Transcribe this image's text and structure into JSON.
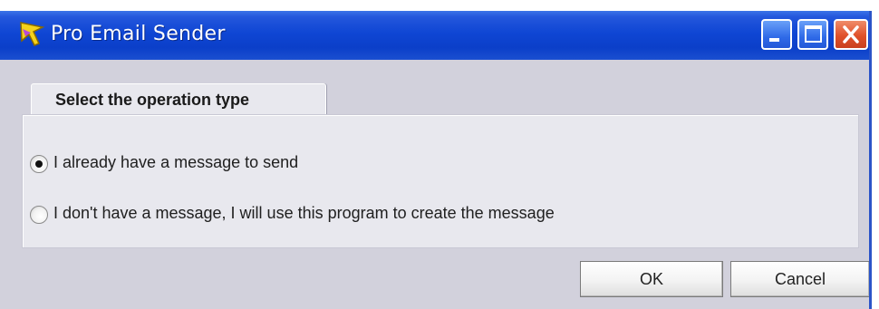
{
  "window": {
    "title": "Pro Email Sender",
    "icon": "yellow-arrow-icon",
    "controls": {
      "minimize": "minimize-icon",
      "maximize": "maximize-icon",
      "close": "close-icon"
    }
  },
  "tab": {
    "label": "Select the operation type"
  },
  "options": [
    {
      "label": "I already have a message to send",
      "selected": true
    },
    {
      "label": "I don't have a message, I will use this program to create the message",
      "selected": false
    }
  ],
  "buttons": {
    "ok_label": "OK",
    "cancel_label": "Cancel"
  },
  "colors": {
    "titlebar": "#0b3fc9",
    "close_button": "#e0512a",
    "dialog_bg": "#d2d1dc",
    "panel_bg": "#e8e8ee"
  }
}
